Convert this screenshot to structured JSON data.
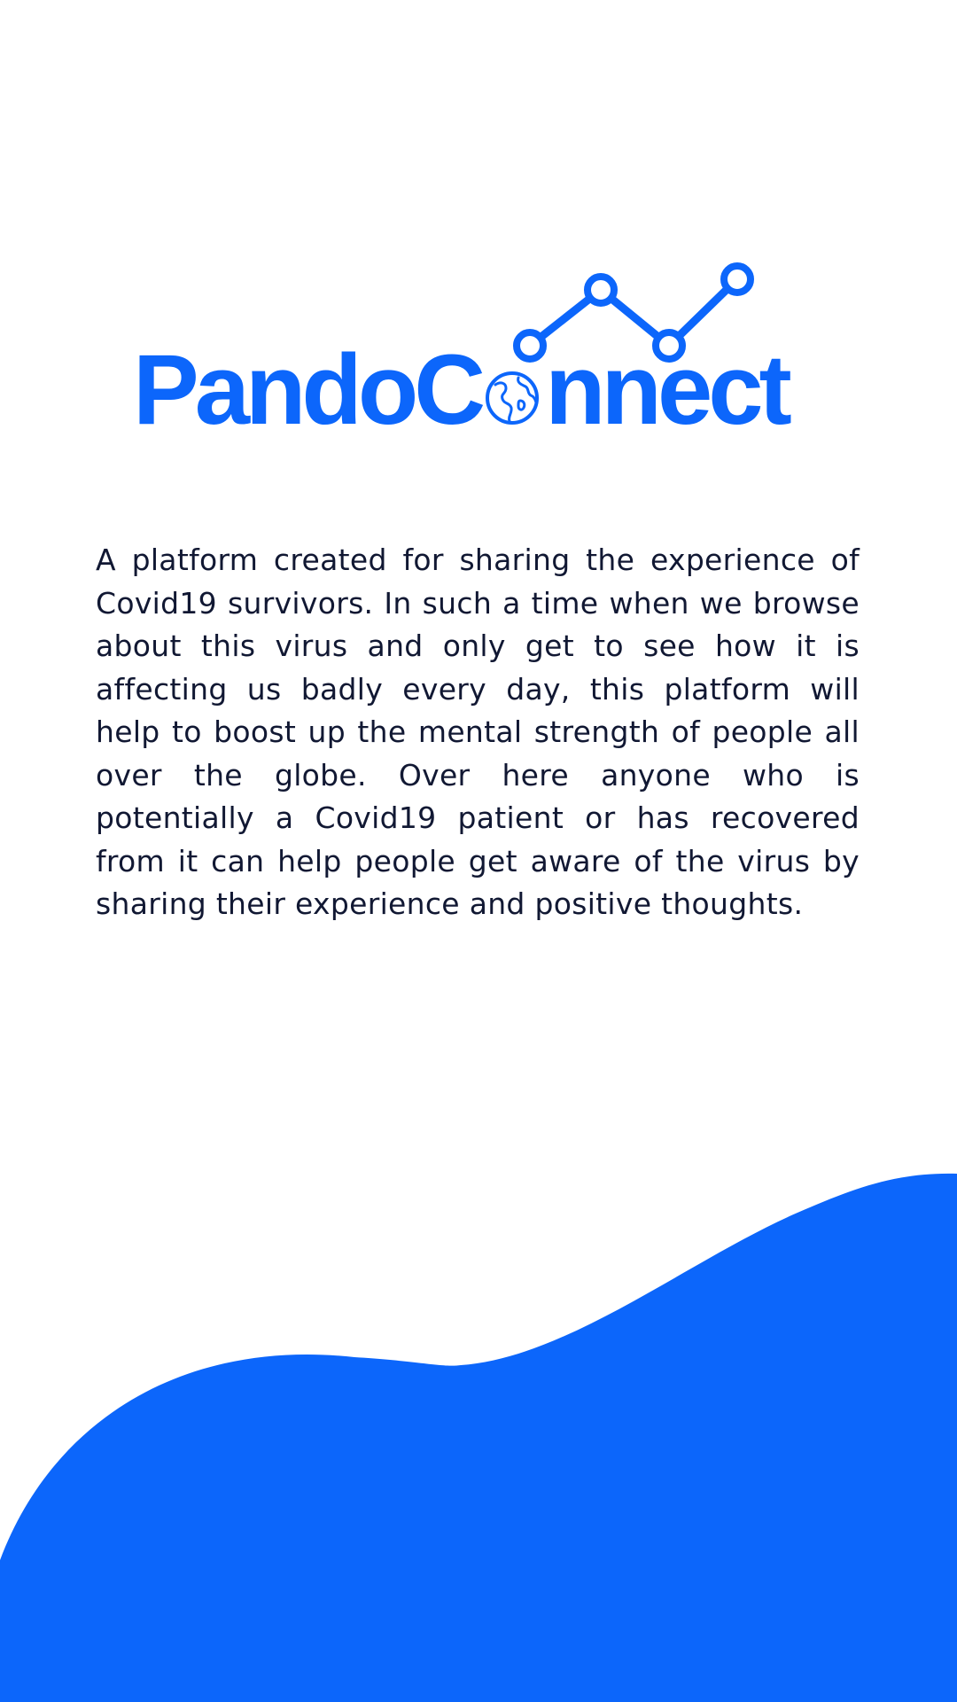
{
  "brand": {
    "name_part1": "PandoC",
    "name_part2": "nnect",
    "logo_icon": "globe-icon",
    "chart_icon": "trend-line-icon",
    "color": "#0c66fb"
  },
  "intro": {
    "description": "A platform created for sharing the experience of Covid19 survivors. In such a time when we browse about this virus and only get to see how it is affecting us badly every day, this platform will help to boost up the mental strength of people all over the globe. Over here anyone who is potentially a Covid19 patient or has recovered from it can help people get aware of the virus by sharing their experience and positive thoughts."
  },
  "colors": {
    "background": "#ffffff",
    "text": "#111833",
    "accent": "#0c66fb"
  }
}
